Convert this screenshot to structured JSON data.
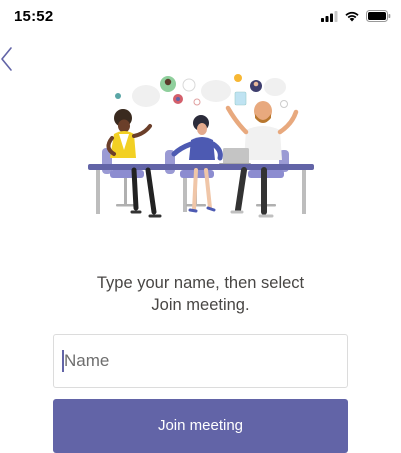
{
  "status_bar": {
    "time": "15:52",
    "icons": [
      "cellular-signal-icon",
      "wifi-icon",
      "battery-icon"
    ]
  },
  "navigation": {
    "back_icon": "chevron-left-icon"
  },
  "illustration": {
    "name": "meeting-illustration"
  },
  "instruction": {
    "line1": "Type your name, then select",
    "line2": "Join meeting."
  },
  "name_field": {
    "value": "",
    "placeholder": "Name"
  },
  "join_button": {
    "label": "Join meeting"
  },
  "colors": {
    "accent": "#6264a7",
    "back_chevron": "#6264a7",
    "text": "#484644",
    "input_border": "#dcdcdc"
  }
}
